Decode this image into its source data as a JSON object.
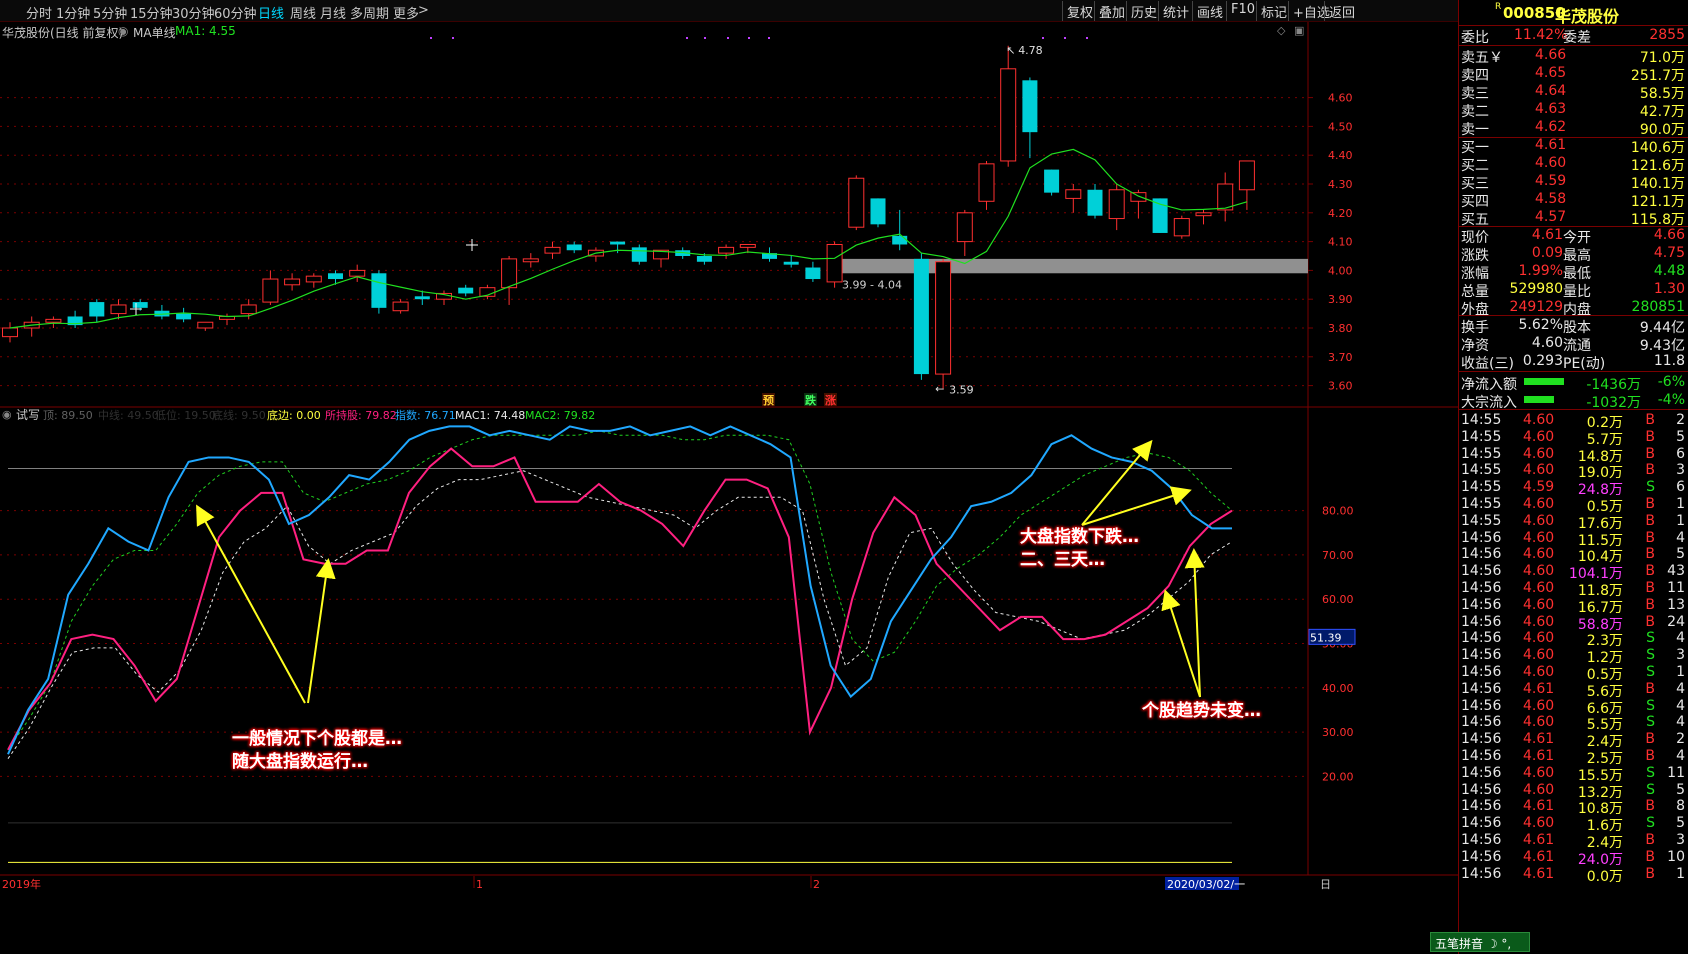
{
  "toolbar": {
    "periods": [
      "分时",
      "1分钟",
      "5分钟",
      "15分钟",
      "30分钟",
      "60分钟",
      "日线",
      "周线",
      "月线",
      "多周期",
      "更多"
    ],
    "active_period": "日线",
    "more_arrow": ">",
    "buttons": [
      "复权",
      "叠加",
      "历史",
      "统计",
      "画线",
      "F10",
      "标记",
      "+自选",
      "返回"
    ]
  },
  "kchart": {
    "stock_label": "华茂股份(日线 前复权)",
    "indicator_name": "MA单线",
    "ma_label": "MA1: 4.55",
    "high_marker": "4.78",
    "low_marker": "3.59",
    "gap_label": "3.99 - 4.04",
    "signals": [
      "预",
      "跌",
      "涨"
    ],
    "price_ticks": [
      "4.60",
      "4.50",
      "4.40",
      "4.30",
      "4.20",
      "4.10",
      "4.00",
      "3.90",
      "3.80",
      "3.70",
      "3.60"
    ]
  },
  "indicator": {
    "name": "试写",
    "labels": [
      {
        "text": "顶: 89.50",
        "color": "#606060"
      },
      {
        "text": "中线: 49.50",
        "color": "#303030"
      },
      {
        "text": "低位: 19.50",
        "color": "#303030"
      },
      {
        "text": "底线: 9.50",
        "color": "#303030"
      },
      {
        "text": "底边: 0.00",
        "color": "#ffff40"
      },
      {
        "text": "所持股: 79.82",
        "color": "#ff2080"
      },
      {
        "text": "指数: 76.71",
        "color": "#20a8ff"
      },
      {
        "text": "MAC1: 74.48",
        "color": "#e8e8e8"
      },
      {
        "text": "MAC2: 79.82",
        "color": "#20e020"
      }
    ],
    "ticks": [
      "80.00",
      "70.00",
      "60.00",
      "50.00",
      "40.00",
      "30.00",
      "20.00"
    ],
    "current_value": "51.39"
  },
  "annotations": {
    "left_line1": "一般情况下个股都是…",
    "left_line2": "随大盘指数运行…",
    "right_top_line1": "大盘指数下跌…",
    "right_top_line2": "二、三天…",
    "right_bottom": "个股趋势未变…"
  },
  "date_axis": {
    "labels": [
      "2019年",
      "1",
      "2"
    ],
    "cursor_date": "2020/03/02/一",
    "end_label": "日"
  },
  "panel": {
    "flag": "R",
    "code": "000850",
    "name": "华茂股份",
    "weibi_label": "委比",
    "weibi_value": "11.42%",
    "weicha_label": "委差",
    "weicha_value": "2855",
    "asks": [
      {
        "label": "卖五￥",
        "price": "4.66",
        "vol": "71.0万"
      },
      {
        "label": "卖四",
        "price": "4.65",
        "vol": "251.7万"
      },
      {
        "label": "卖三",
        "price": "4.64",
        "vol": "58.5万"
      },
      {
        "label": "卖二",
        "price": "4.63",
        "vol": "42.7万"
      },
      {
        "label": "卖一",
        "price": "4.62",
        "vol": "90.0万"
      }
    ],
    "bids": [
      {
        "label": "买一",
        "price": "4.61",
        "vol": "140.6万"
      },
      {
        "label": "买二",
        "price": "4.60",
        "vol": "121.6万"
      },
      {
        "label": "买三",
        "price": "4.59",
        "vol": "140.1万"
      },
      {
        "label": "买四",
        "price": "4.58",
        "vol": "121.1万"
      },
      {
        "label": "买五",
        "price": "4.57",
        "vol": "115.8万"
      }
    ],
    "quote": [
      {
        "l1": "现价",
        "v1": "4.61",
        "c1": "red",
        "l2": "今开",
        "v2": "4.66",
        "c2": "red"
      },
      {
        "l1": "涨跌",
        "v1": "0.09",
        "c1": "red",
        "l2": "最高",
        "v2": "4.75",
        "c2": "red"
      },
      {
        "l1": "涨幅",
        "v1": "1.99%",
        "c1": "red",
        "l2": "最低",
        "v2": "4.48",
        "c2": "grn"
      },
      {
        "l1": "总量",
        "v1": "529980",
        "c1": "yel",
        "l2": "量比",
        "v2": "1.30",
        "c2": "red"
      },
      {
        "l1": "外盘",
        "v1": "249129",
        "c1": "red",
        "l2": "内盘",
        "v2": "280851",
        "c2": "grn"
      }
    ],
    "stats": [
      {
        "l1": "换手",
        "v1": "5.62%",
        "l2": "股本",
        "v2": "9.44亿"
      },
      {
        "l1": "净资",
        "v1": "4.60",
        "l2": "流通",
        "v2": "9.43亿"
      },
      {
        "l1": "收益(三)",
        "v1": "0.293",
        "l2": "PE(动)",
        "v2": "11.8"
      }
    ],
    "flows": [
      {
        "label": "净流入额",
        "value": "-1436万",
        "pct": "-6%"
      },
      {
        "label": "大宗流入",
        "value": "-1032万",
        "pct": "-4%"
      }
    ],
    "ticks": [
      {
        "t": "14:55",
        "p": "4.60",
        "v": "0.2万",
        "s": "B",
        "n": "2",
        "pc": "red",
        "vc": "yel"
      },
      {
        "t": "14:55",
        "p": "4.60",
        "v": "5.7万",
        "s": "B",
        "n": "5",
        "pc": "red",
        "vc": "yel"
      },
      {
        "t": "14:55",
        "p": "4.60",
        "v": "14.8万",
        "s": "B",
        "n": "6",
        "pc": "red",
        "vc": "yel"
      },
      {
        "t": "14:55",
        "p": "4.60",
        "v": "19.0万",
        "s": "B",
        "n": "3",
        "pc": "red",
        "vc": "yel"
      },
      {
        "t": "14:55",
        "p": "4.59",
        "v": "24.8万",
        "s": "S",
        "n": "6",
        "pc": "red",
        "vc": "mag"
      },
      {
        "t": "14:55",
        "p": "4.60",
        "v": "0.5万",
        "s": "B",
        "n": "1",
        "pc": "red",
        "vc": "yel"
      },
      {
        "t": "14:55",
        "p": "4.60",
        "v": "17.6万",
        "s": "B",
        "n": "1",
        "pc": "red",
        "vc": "yel"
      },
      {
        "t": "14:56",
        "p": "4.60",
        "v": "11.5万",
        "s": "B",
        "n": "4",
        "pc": "red",
        "vc": "yel"
      },
      {
        "t": "14:56",
        "p": "4.60",
        "v": "10.4万",
        "s": "B",
        "n": "5",
        "pc": "red",
        "vc": "yel"
      },
      {
        "t": "14:56",
        "p": "4.60",
        "v": "104.1万",
        "s": "B",
        "n": "43",
        "pc": "red",
        "vc": "mag"
      },
      {
        "t": "14:56",
        "p": "4.60",
        "v": "11.8万",
        "s": "B",
        "n": "11",
        "pc": "red",
        "vc": "yel"
      },
      {
        "t": "14:56",
        "p": "4.60",
        "v": "16.7万",
        "s": "B",
        "n": "13",
        "pc": "red",
        "vc": "yel"
      },
      {
        "t": "14:56",
        "p": "4.60",
        "v": "58.8万",
        "s": "B",
        "n": "24",
        "pc": "red",
        "vc": "mag"
      },
      {
        "t": "14:56",
        "p": "4.60",
        "v": "2.3万",
        "s": "S",
        "n": "4",
        "pc": "red",
        "vc": "yel"
      },
      {
        "t": "14:56",
        "p": "4.60",
        "v": "1.2万",
        "s": "S",
        "n": "3",
        "pc": "red",
        "vc": "yel"
      },
      {
        "t": "14:56",
        "p": "4.60",
        "v": "0.5万",
        "s": "S",
        "n": "1",
        "pc": "red",
        "vc": "yel"
      },
      {
        "t": "14:56",
        "p": "4.61",
        "v": "5.6万",
        "s": "B",
        "n": "4",
        "pc": "red",
        "vc": "yel"
      },
      {
        "t": "14:56",
        "p": "4.60",
        "v": "6.6万",
        "s": "S",
        "n": "4",
        "pc": "red",
        "vc": "yel"
      },
      {
        "t": "14:56",
        "p": "4.60",
        "v": "5.5万",
        "s": "S",
        "n": "4",
        "pc": "red",
        "vc": "yel"
      },
      {
        "t": "14:56",
        "p": "4.61",
        "v": "2.4万",
        "s": "B",
        "n": "2",
        "pc": "red",
        "vc": "yel"
      },
      {
        "t": "14:56",
        "p": "4.61",
        "v": "2.5万",
        "s": "B",
        "n": "4",
        "pc": "red",
        "vc": "yel"
      },
      {
        "t": "14:56",
        "p": "4.60",
        "v": "15.5万",
        "s": "S",
        "n": "11",
        "pc": "red",
        "vc": "yel"
      },
      {
        "t": "14:56",
        "p": "4.60",
        "v": "13.2万",
        "s": "S",
        "n": "5",
        "pc": "red",
        "vc": "yel"
      },
      {
        "t": "14:56",
        "p": "4.61",
        "v": "10.8万",
        "s": "B",
        "n": "8",
        "pc": "red",
        "vc": "yel"
      },
      {
        "t": "14:56",
        "p": "4.60",
        "v": "1.6万",
        "s": "S",
        "n": "5",
        "pc": "red",
        "vc": "yel"
      },
      {
        "t": "14:56",
        "p": "4.61",
        "v": "2.4万",
        "s": "B",
        "n": "3",
        "pc": "red",
        "vc": "yel"
      },
      {
        "t": "14:56",
        "p": "4.61",
        "v": "24.0万",
        "s": "B",
        "n": "10",
        "pc": "red",
        "vc": "mag"
      },
      {
        "t": "14:56",
        "p": "4.61",
        "v": "0.0万",
        "s": "B",
        "n": "1",
        "pc": "red",
        "vc": "yel"
      }
    ],
    "ime_label": "五笔拼音"
  },
  "colors": {
    "up": "#ff3030",
    "down": "#00d0d8",
    "ma": "#20e020",
    "grid": "#7a0000",
    "stock_line": "#ff2080",
    "index_line": "#20a8ff",
    "mac1": "#e8e8e8",
    "mac2": "#20d020",
    "annotation_text": "#ffffff",
    "annotation_bg": "#ff2020",
    "arrow": "#ffff20"
  },
  "chart_data": {
    "type": "candlestick",
    "x": [
      "1",
      "2",
      "3",
      "4",
      "5",
      "6",
      "7",
      "8",
      "9",
      "10",
      "11",
      "12",
      "13",
      "14",
      "15",
      "16",
      "17",
      "18",
      "19",
      "20",
      "21",
      "22",
      "23",
      "24",
      "25",
      "26",
      "27",
      "28",
      "29",
      "30",
      "31",
      "32",
      "33",
      "34",
      "35",
      "36",
      "37",
      "38",
      "39",
      "40",
      "41",
      "42",
      "43",
      "44",
      "45",
      "46",
      "47",
      "48",
      "49",
      "50",
      "51",
      "52",
      "53",
      "54",
      "55",
      "56",
      "57",
      "58"
    ],
    "ohlc": [
      [
        3.77,
        3.82,
        3.75,
        3.8
      ],
      [
        3.8,
        3.84,
        3.77,
        3.82
      ],
      [
        3.82,
        3.84,
        3.8,
        3.83
      ],
      [
        3.84,
        3.86,
        3.8,
        3.81
      ],
      [
        3.89,
        3.9,
        3.82,
        3.84
      ],
      [
        3.85,
        3.9,
        3.83,
        3.88
      ],
      [
        3.89,
        3.9,
        3.86,
        3.87
      ],
      [
        3.86,
        3.88,
        3.83,
        3.84
      ],
      [
        3.85,
        3.87,
        3.82,
        3.83
      ],
      [
        3.8,
        3.82,
        3.79,
        3.82
      ],
      [
        3.83,
        3.85,
        3.81,
        3.84
      ],
      [
        3.85,
        3.9,
        3.83,
        3.88
      ],
      [
        3.89,
        4.0,
        3.88,
        3.97
      ],
      [
        3.95,
        3.99,
        3.93,
        3.97
      ],
      [
        3.96,
        3.99,
        3.94,
        3.98
      ],
      [
        3.99,
        4.0,
        3.95,
        3.97
      ],
      [
        3.98,
        4.02,
        3.96,
        4.0
      ],
      [
        3.99,
        4.0,
        3.85,
        3.87
      ],
      [
        3.86,
        3.9,
        3.85,
        3.89
      ],
      [
        3.91,
        3.93,
        3.88,
        3.9
      ],
      [
        3.9,
        3.93,
        3.88,
        3.92
      ],
      [
        3.94,
        3.95,
        3.91,
        3.92
      ],
      [
        3.91,
        3.95,
        3.9,
        3.94
      ],
      [
        3.94,
        4.05,
        3.88,
        4.04
      ],
      [
        4.03,
        4.06,
        4.01,
        4.04
      ],
      [
        4.06,
        4.1,
        4.04,
        4.08
      ],
      [
        4.09,
        4.1,
        4.06,
        4.07
      ],
      [
        4.05,
        4.08,
        4.03,
        4.07
      ],
      [
        4.1,
        4.1,
        4.06,
        4.09
      ],
      [
        4.08,
        4.09,
        4.02,
        4.03
      ],
      [
        4.04,
        4.06,
        4.01,
        4.07
      ],
      [
        4.07,
        4.08,
        4.04,
        4.05
      ],
      [
        4.05,
        4.06,
        4.02,
        4.03
      ],
      [
        4.06,
        4.09,
        4.04,
        4.08
      ],
      [
        4.08,
        4.09,
        4.06,
        4.09
      ],
      [
        4.06,
        4.08,
        4.03,
        4.04
      ],
      [
        4.03,
        4.05,
        4.01,
        4.02
      ],
      [
        4.01,
        4.03,
        3.96,
        3.97
      ],
      [
        3.96,
        4.1,
        3.94,
        4.09
      ],
      [
        4.15,
        4.33,
        4.14,
        4.32
      ],
      [
        4.25,
        4.25,
        4.15,
        4.16
      ],
      [
        4.12,
        4.21,
        4.07,
        4.09
      ],
      [
        4.04,
        4.06,
        3.62,
        3.64
      ],
      [
        3.64,
        4.04,
        3.59,
        4.03
      ],
      [
        4.1,
        4.21,
        4.05,
        4.2
      ],
      [
        4.24,
        4.38,
        4.21,
        4.37
      ],
      [
        4.38,
        4.78,
        4.36,
        4.7
      ],
      [
        4.66,
        4.67,
        4.39,
        4.48
      ],
      [
        4.35,
        4.35,
        4.26,
        4.27
      ],
      [
        4.25,
        4.3,
        4.2,
        4.28
      ],
      [
        4.28,
        4.3,
        4.18,
        4.19
      ],
      [
        4.18,
        4.3,
        4.14,
        4.28
      ],
      [
        4.24,
        4.28,
        4.18,
        4.27
      ],
      [
        4.25,
        4.25,
        4.13,
        4.13
      ],
      [
        4.12,
        4.19,
        4.11,
        4.18
      ],
      [
        4.19,
        4.21,
        4.16,
        4.2
      ],
      [
        4.21,
        4.34,
        4.17,
        4.3
      ],
      [
        4.28,
        4.38,
        4.21,
        4.38
      ]
    ],
    "ylim": [
      3.55,
      4.8
    ],
    "indicator_ylim": [
      0,
      100
    ]
  }
}
